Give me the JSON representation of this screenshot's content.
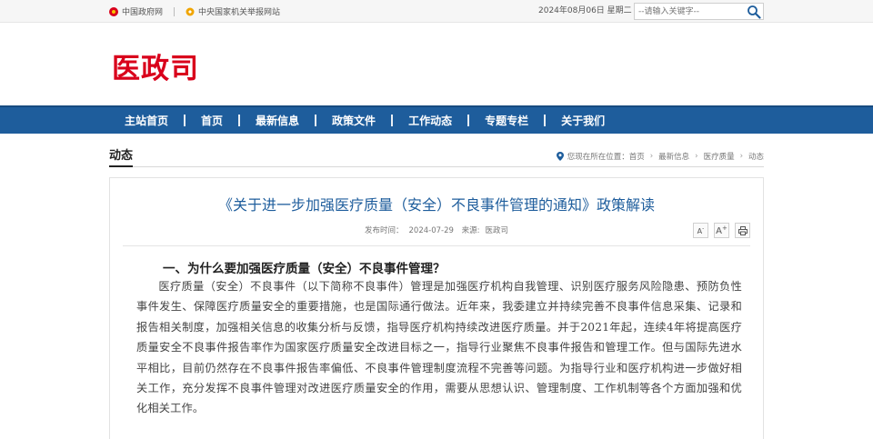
{
  "topbar": {
    "link1": "中国政府网",
    "link2": "中央国家机关举报网站",
    "date": "2024年08月06日 星期二",
    "search_placeholder": "--请输入关键字--"
  },
  "site": {
    "logo": "医政司"
  },
  "nav": {
    "items": [
      "主站首页",
      "首页",
      "最新信息",
      "政策文件",
      "工作动态",
      "专题专栏",
      "关于我们"
    ]
  },
  "section": {
    "title": "动态",
    "breadcrumb": {
      "prefix": "您现在所在位置：",
      "items": [
        "首页",
        "最新信息",
        "医疗质量",
        "动态"
      ]
    }
  },
  "article": {
    "title": "《关于进一步加强医疗质量（安全）不良事件管理的通知》政策解读",
    "publish_label": "发布时间：",
    "publish_date": "2024-07-29",
    "source_label": "来源:",
    "source": "医政司",
    "tools": {
      "font_small": "A",
      "font_large": "A",
      "print": "print-icon"
    },
    "heading1": "一、为什么要加强医疗质量（安全）不良事件管理？",
    "paragraph1": "医疗质量（安全）不良事件（以下简称不良事件）管理是加强医疗机构自我管理、识别医疗服务风险隐患、预防负性事件发生、保障医疗质量安全的重要措施，也是国际通行做法。近年来，我委建立并持续完善不良事件信息采集、记录和报告相关制度，加强相关信息的收集分析与反馈，指导医疗机构持续改进医疗质量。并于2021年起，连续4年将提高医疗质量安全不良事件报告率作为国家医疗质量安全改进目标之一，指导行业聚焦不良事件报告和管理工作。但与国际先进水平相比，目前仍然存在不良事件报告率偏低、不良事件管理制度流程不完善等问题。为指导行业和医疗机构进一步做好相关工作，充分发挥不良事件管理对改进医疗质量安全的作用，需要从思想认识、管理制度、工作机制等各个方面加强和优化相关工作。"
  },
  "colors": {
    "brand_red": "#d9001b",
    "nav_blue": "#1e5d9c"
  }
}
